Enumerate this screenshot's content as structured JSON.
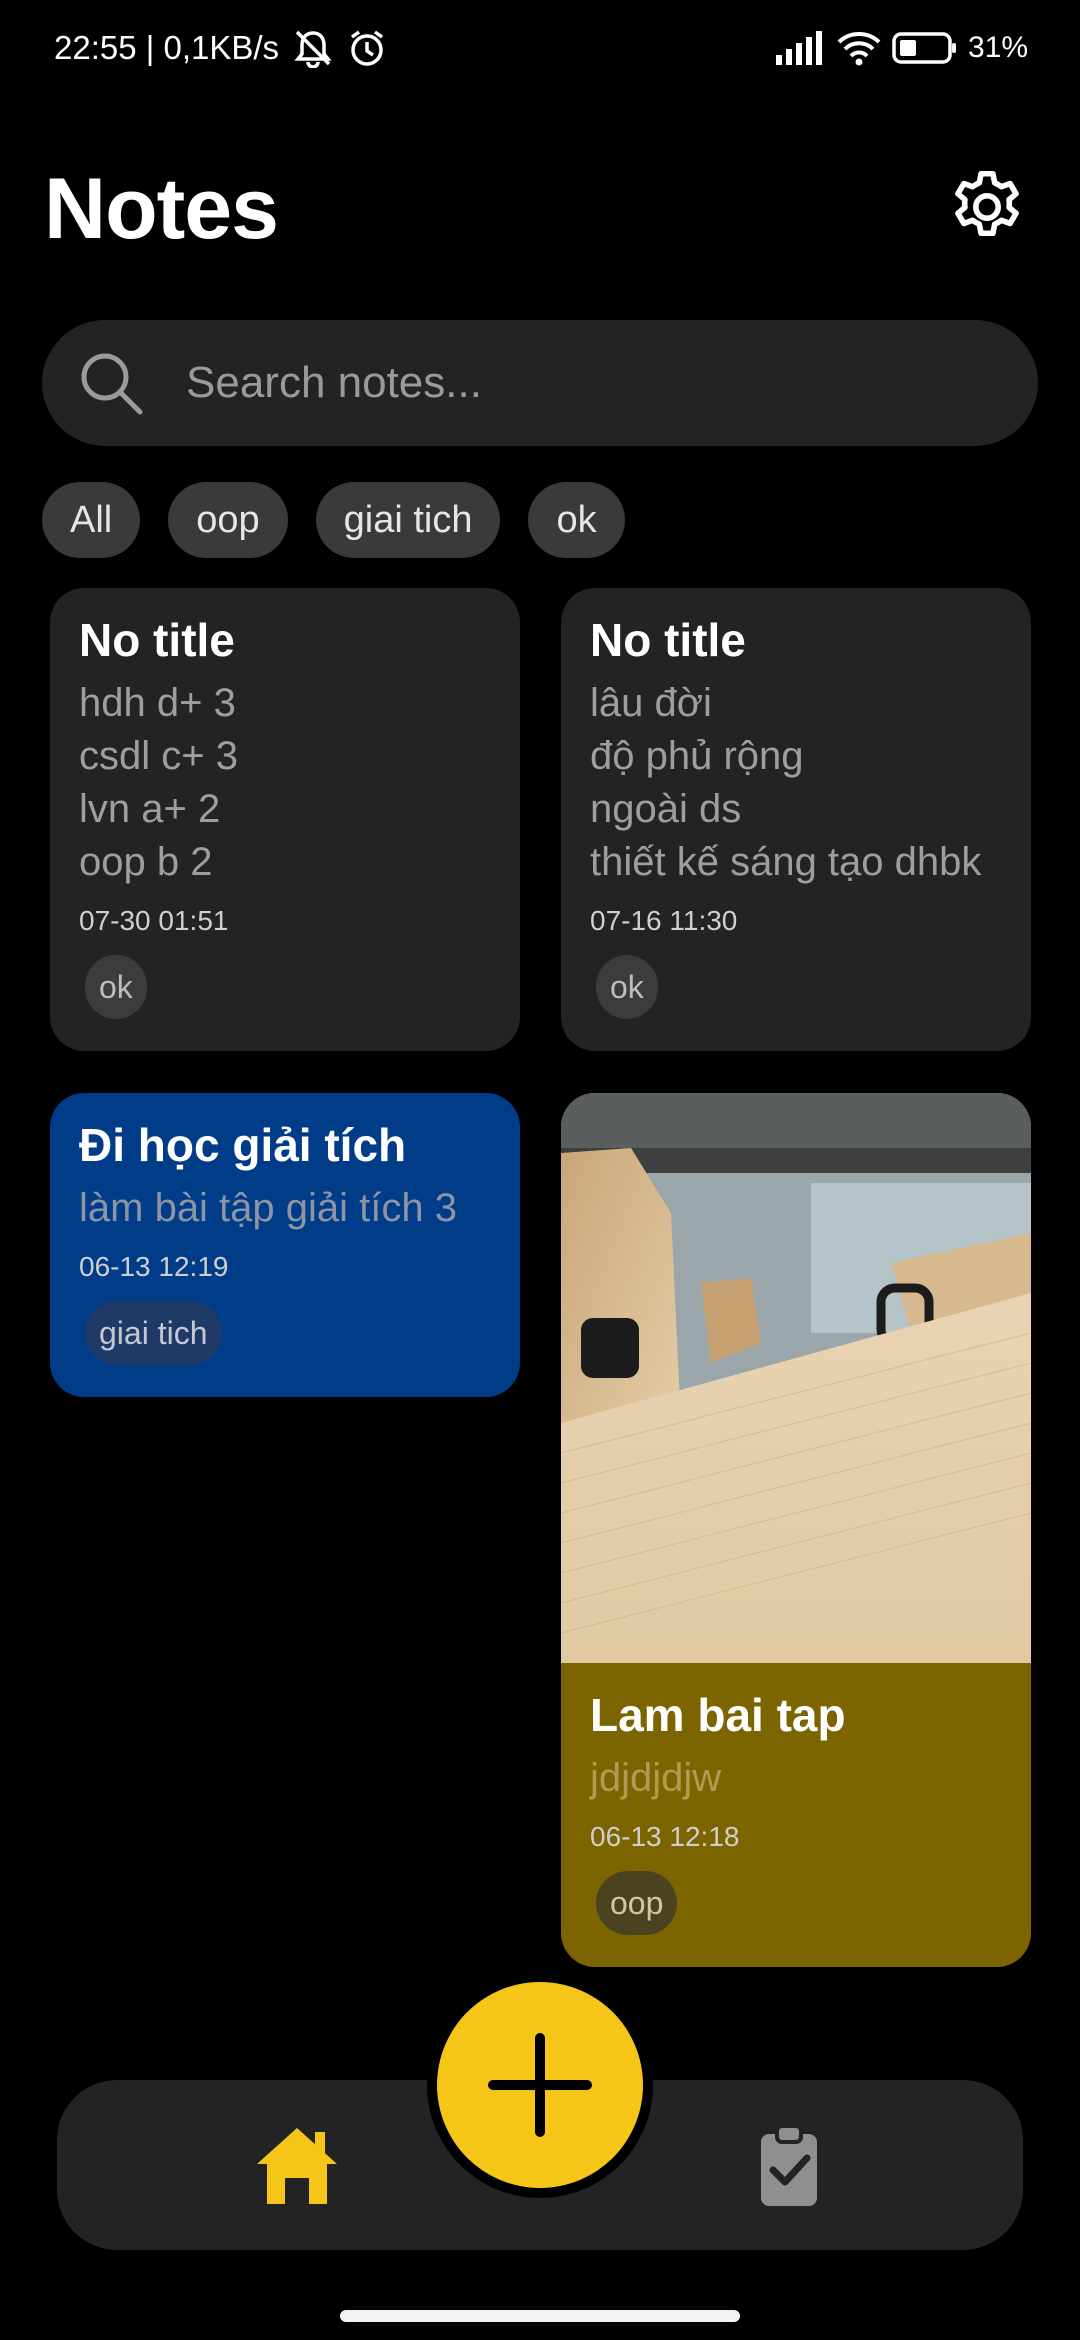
{
  "status_bar": {
    "time_speed": "22:55 | 0,1KB/s",
    "battery": "31%"
  },
  "header": {
    "title": "Notes"
  },
  "search": {
    "placeholder": "Search notes..."
  },
  "filters": [
    {
      "label": "All"
    },
    {
      "label": "oop"
    },
    {
      "label": "giai tich"
    },
    {
      "label": "ok"
    }
  ],
  "notes": [
    {
      "title": "No title",
      "lines": [
        "hdh d+ 3",
        "csdl c+ 3",
        "lvn a+ 2",
        "oop b 2"
      ],
      "date": "07-30 01:51",
      "tag": "ok",
      "color": "#232323"
    },
    {
      "title": "No title",
      "lines": [
        "lâu đời",
        "độ phủ rộng",
        "ngoài ds",
        "thiết kế sáng tạo dhbk"
      ],
      "date": "07-16 11:30",
      "tag": "ok",
      "color": "#232323"
    },
    {
      "title": "Đi học giải tích",
      "lines": [
        "làm bài tập giải tích 3"
      ],
      "date": "06-13 12:19",
      "tag": "giai tich",
      "color": "#003c88"
    },
    {
      "title": "Lam bai tap",
      "lines": [
        "jdjdjdjw"
      ],
      "date": "06-13 12:18",
      "tag": "oop",
      "color": "#7c6500",
      "has_photo": true
    }
  ],
  "colors": {
    "accent": "#f5c518",
    "surface": "#232323",
    "background": "#000000"
  },
  "nav": {
    "home_icon": "home-icon",
    "tasks_icon": "clipboard-check-icon",
    "add_icon": "plus-icon"
  }
}
